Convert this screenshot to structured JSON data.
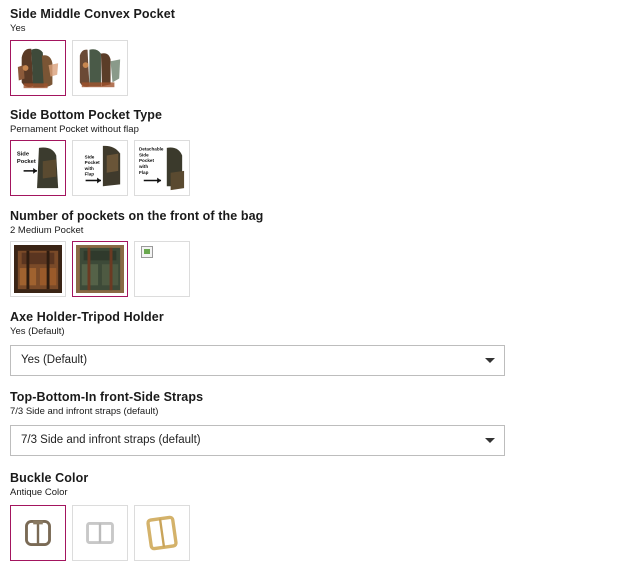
{
  "options": [
    {
      "title": "Side Middle Convex Pocket",
      "value": "Yes",
      "swatches": [
        {
          "name": "backpack-side-pocket-photo-1"
        },
        {
          "name": "backpack-side-pocket-photo-2"
        }
      ]
    },
    {
      "title": "Side Bottom Pocket Type",
      "value": "Pernament Pocket without flap",
      "swatches": [
        {
          "label_lines": [
            "Side",
            "Pocket"
          ]
        },
        {
          "label_lines": [
            "Side",
            "Pocket",
            "with",
            "Flap"
          ]
        },
        {
          "label_lines": [
            "Detachable",
            "Side",
            "Pocket",
            "with",
            "Flap"
          ]
        }
      ]
    },
    {
      "title": "Number of pockets on the front of the bag",
      "value": "2 Medium Pocket",
      "swatches": [
        {
          "name": "front-pocket-photo-1"
        },
        {
          "name": "front-pocket-photo-2"
        },
        {
          "name": "broken-image"
        }
      ]
    },
    {
      "title": "Axe Holder-Tripod Holder",
      "value": "Yes (Default)",
      "select_value": "Yes (Default)"
    },
    {
      "title": "Top-Bottom-In front-Side Straps",
      "value": "7/3 Side and infront straps (default)",
      "select_value": "7/3 Side and infront straps (default)"
    },
    {
      "title": "Buckle Color",
      "value": "Antique Color",
      "swatches": [
        {
          "name": "antique-buckle"
        },
        {
          "name": "silver-buckle"
        },
        {
          "name": "gold-buckle"
        }
      ]
    }
  ],
  "colors": {
    "accent": "#a3155e",
    "border": "#dcdcdc"
  },
  "icons": {
    "dropdown": "chevron-down-icon",
    "broken": "broken-image-icon"
  }
}
